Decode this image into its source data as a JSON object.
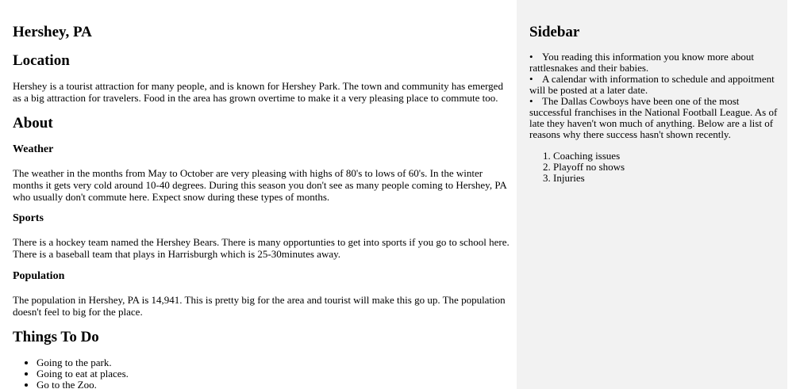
{
  "main": {
    "title": "Hershey, PA",
    "location_heading": "Location",
    "location_text": "Hershey is a tourist attraction for many people, and is known for Hershey Park. The town and community has emerged as a big attraction for travelers. Food in the area has grown overtime to make it a very pleasing place to commute too.",
    "about_heading": "About",
    "weather_heading": "Weather",
    "weather_text": "The weather in the months from May to October are very pleasing with highs of 80's to lows of 60's. In the winter months it gets very cold around 10-40 degrees. During this season you don't see as many people coming to Hershey, PA who usually don't commute here. Expect snow during these types of months.",
    "sports_heading": "Sports",
    "sports_text": "There is a hockey team named the Hershey Bears. There is many opportunties to get into sports if you go to school here. There is a baseball team that plays in Harrisburgh which is 25-30minutes away.",
    "population_heading": "Population",
    "population_text": "The population in Hershey, PA is 14,941. This is pretty big for the area and tourist will make this go up. The population doesn't feel to big for the place.",
    "things_heading": "Things To Do",
    "things_items": [
      "Going to the park.",
      "Going to eat at places.",
      "Go to the Zoo."
    ]
  },
  "sidebar": {
    "title": "Sidebar",
    "bullets": [
      "You reading this information you know more about rattlesnakes and their babies.",
      "A calendar with information to schedule and appoitment will be posted at a later date.",
      "The Dallas Cowboys have been one of the most successful franchises in the National Football League. As of late they haven't won much of anything. Below are a list of reasons why there success hasn't shown recently."
    ],
    "reasons": [
      "Coaching issues",
      "Playoff no shows",
      "Injuries"
    ]
  }
}
